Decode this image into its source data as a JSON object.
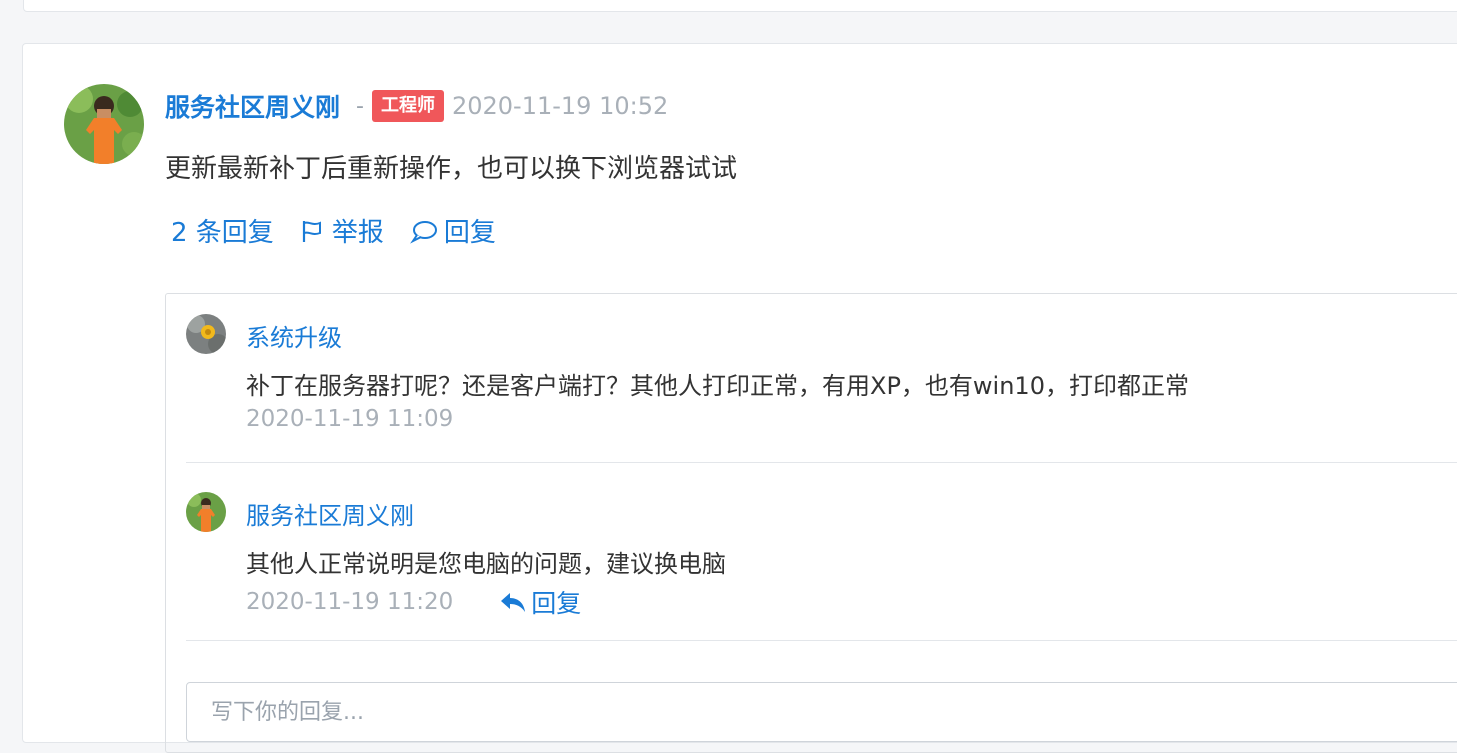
{
  "post": {
    "author": "服务社区周义刚",
    "separator": "-",
    "role_badge": "工程师",
    "time": "2020-11-19 10:52",
    "body": "更新最新补丁后重新操作，也可以换下浏览器试试",
    "actions": {
      "replies_count": "2 条回复",
      "report": "举报",
      "reply": "回复"
    }
  },
  "replies": [
    {
      "author": "系统升级",
      "text": "补丁在服务器打呢？还是客户端打？其他人打印正常，有用XP，也有win10，打印都正常",
      "time": "2020-11-19 11:09"
    },
    {
      "author": "服务社区周义刚",
      "text": "其他人正常说明是您电脑的问题，建议换电脑",
      "time": "2020-11-19 11:20",
      "reply_label": "回复"
    }
  ],
  "reply_input": {
    "placeholder": "写下你的回复..."
  },
  "colors": {
    "accent": "#1a7bd6",
    "badge": "#f0575a",
    "muted": "#a9b0b8",
    "text": "#333333"
  }
}
